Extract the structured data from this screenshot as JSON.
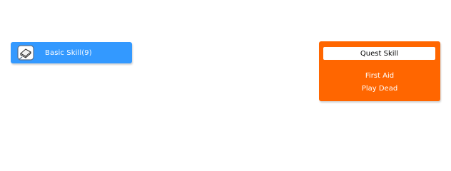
{
  "basic_skill": {
    "icon": "book-icon",
    "label": "Basic Skill(9)",
    "color": "#3399ff"
  },
  "quest_skill": {
    "title": "Quest Skill",
    "color": "#ff6600",
    "items": [
      "First Aid",
      "Play Dead"
    ]
  }
}
